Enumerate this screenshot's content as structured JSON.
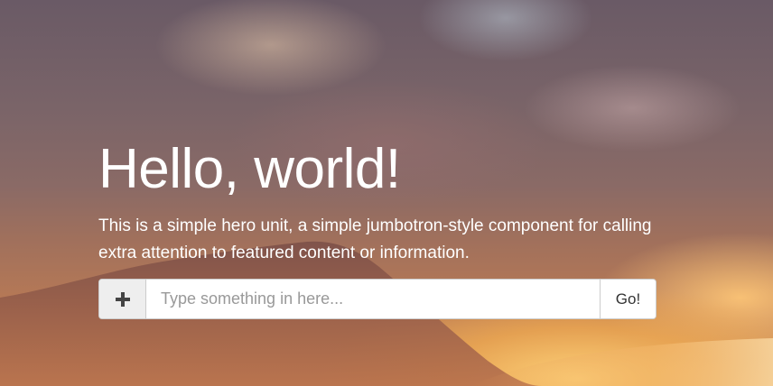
{
  "hero": {
    "title": "Hello, world!",
    "lead": "This is a simple hero unit, a simple jumbotron-style component for calling extra attention to featured content or information."
  },
  "search": {
    "placeholder": "Type something in here...",
    "value": "",
    "add_icon": "plus-icon",
    "submit_label": "Go!"
  },
  "colors": {
    "title_text": "#ffffff",
    "addon_background": "#eeeeee",
    "input_border": "#cccccc"
  }
}
